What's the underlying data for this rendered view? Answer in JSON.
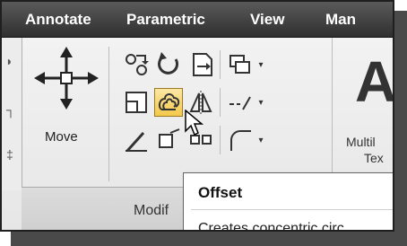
{
  "tabs": [
    "Annotate",
    "Parametric",
    "View",
    "Man"
  ],
  "left_partial_icons": [
    "◗",
    "┐",
    "‡"
  ],
  "move_label": "Move",
  "panel_footer_label": "Modif",
  "text_tool": {
    "big_glyph": "A",
    "label_line1": "Multil",
    "label_line2": "Tex"
  },
  "tooltip": {
    "title": "Offset",
    "description": "Creates concentric circ"
  },
  "icons": {
    "move": "move-arrows-icon",
    "copy": "copy-icon",
    "rotate": "rotate-icon",
    "trim": "trim-icon",
    "stretch": "stretch-icon",
    "offset": "offset-icon",
    "mirror": "mirror-icon",
    "linetype": "dash-line-icon",
    "fillet": "fillet-icon",
    "explode": "explode-icon",
    "array": "array-icon",
    "arc": "arc-icon"
  },
  "colors": {
    "tabbar": "#3a3a3a",
    "active_button": "#f3c94c"
  }
}
